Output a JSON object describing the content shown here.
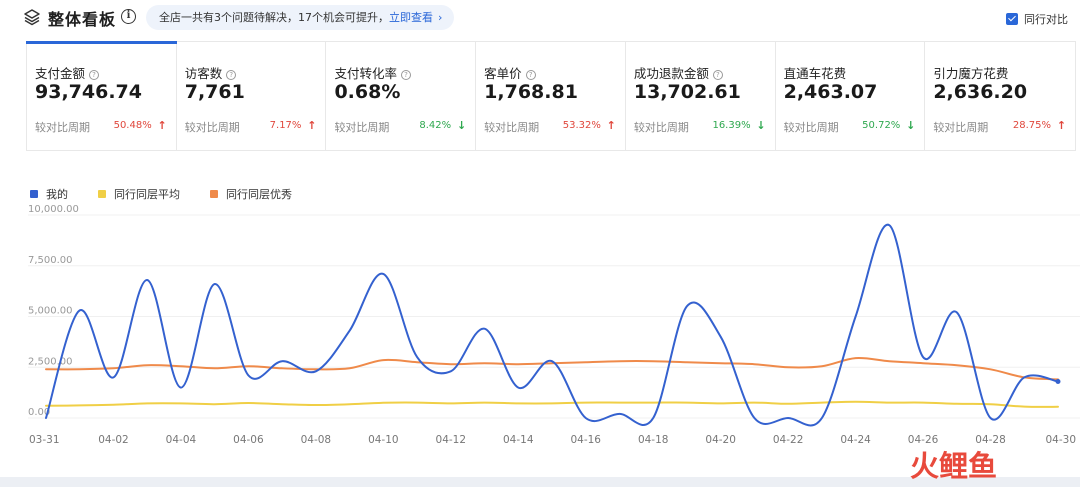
{
  "header": {
    "title": "整体看板",
    "notice_text": "全店一共有3个问题待解决，17个机会可提升，",
    "notice_link": "立即查看",
    "notice_chevron": "›",
    "compare_label": "同行对比",
    "compare_checked": true,
    "layers_icon": "layers-icon",
    "info_icon": "info-icon"
  },
  "cards": [
    {
      "label": "支付金额",
      "value": "93,746.74",
      "compare": "较对比周期",
      "pct": "50.48%",
      "dir": "up"
    },
    {
      "label": "访客数",
      "value": "7,761",
      "compare": "较对比周期",
      "pct": "7.17%",
      "dir": "up"
    },
    {
      "label": "支付转化率",
      "value": "0.68%",
      "compare": "较对比周期",
      "pct": "8.42%",
      "dir": "down"
    },
    {
      "label": "客单价",
      "value": "1,768.81",
      "compare": "较对比周期",
      "pct": "53.32%",
      "dir": "up"
    },
    {
      "label": "成功退款金额",
      "value": "13,702.61",
      "compare": "较对比周期",
      "pct": "16.39%",
      "dir": "down"
    },
    {
      "label": "直通车花费",
      "value": "2,463.07",
      "compare": "较对比周期",
      "pct": "50.72%",
      "dir": "down"
    },
    {
      "label": "引力魔方花费",
      "value": "2,636.20",
      "compare": "较对比周期",
      "pct": "28.75%",
      "dir": "up"
    }
  ],
  "colors": {
    "accent": "#2a67d8",
    "up": "#e0473c",
    "down": "#2fa84f",
    "series_mine": "#3461cf",
    "series_avg": "#f0cf46",
    "series_top": "#ef8a4a"
  },
  "watermark": "火鲤鱼",
  "chart_data": {
    "type": "line",
    "x": [
      "03-31",
      "04-01",
      "04-02",
      "04-03",
      "04-04",
      "04-05",
      "04-06",
      "04-07",
      "04-08",
      "04-09",
      "04-10",
      "04-11",
      "04-12",
      "04-13",
      "04-14",
      "04-15",
      "04-16",
      "04-17",
      "04-18",
      "04-19",
      "04-20",
      "04-21",
      "04-22",
      "04-23",
      "04-24",
      "04-25",
      "04-26",
      "04-27",
      "04-28",
      "04-29",
      "04-30"
    ],
    "xticks": [
      "03-31",
      "04-02",
      "04-04",
      "04-06",
      "04-08",
      "04-10",
      "04-12",
      "04-14",
      "04-16",
      "04-18",
      "04-20",
      "04-22",
      "04-24",
      "04-26",
      "04-28",
      "04-30"
    ],
    "yticks": [
      0,
      2500,
      5000,
      7500,
      10000
    ],
    "ytick_labels": [
      "0.00",
      "2,500.00",
      "5,000.00",
      "7,500.00",
      "10,000.00"
    ],
    "ylim": [
      0,
      10000
    ],
    "series": [
      {
        "name": "我的",
        "values": [
          0,
          5300,
          2000,
          6800,
          1500,
          6600,
          2100,
          2800,
          2300,
          4300,
          7100,
          3000,
          2300,
          4400,
          1500,
          2800,
          0,
          200,
          0,
          5500,
          4000,
          0,
          0,
          0,
          5000,
          9500,
          3000,
          5200,
          0,
          2000,
          1800
        ]
      },
      {
        "name": "同行同层平均",
        "values": [
          600,
          620,
          650,
          720,
          720,
          680,
          740,
          680,
          640,
          680,
          750,
          760,
          720,
          760,
          720,
          720,
          760,
          760,
          760,
          760,
          720,
          760,
          700,
          760,
          800,
          760,
          760,
          700,
          680,
          560,
          550
        ]
      },
      {
        "name": "同行同层优秀",
        "values": [
          2400,
          2400,
          2450,
          2600,
          2550,
          2450,
          2550,
          2450,
          2400,
          2450,
          2850,
          2750,
          2650,
          2700,
          2650,
          2700,
          2750,
          2800,
          2800,
          2750,
          2700,
          2650,
          2500,
          2550,
          2950,
          2800,
          2700,
          2600,
          2400,
          2000,
          1900
        ]
      }
    ]
  }
}
